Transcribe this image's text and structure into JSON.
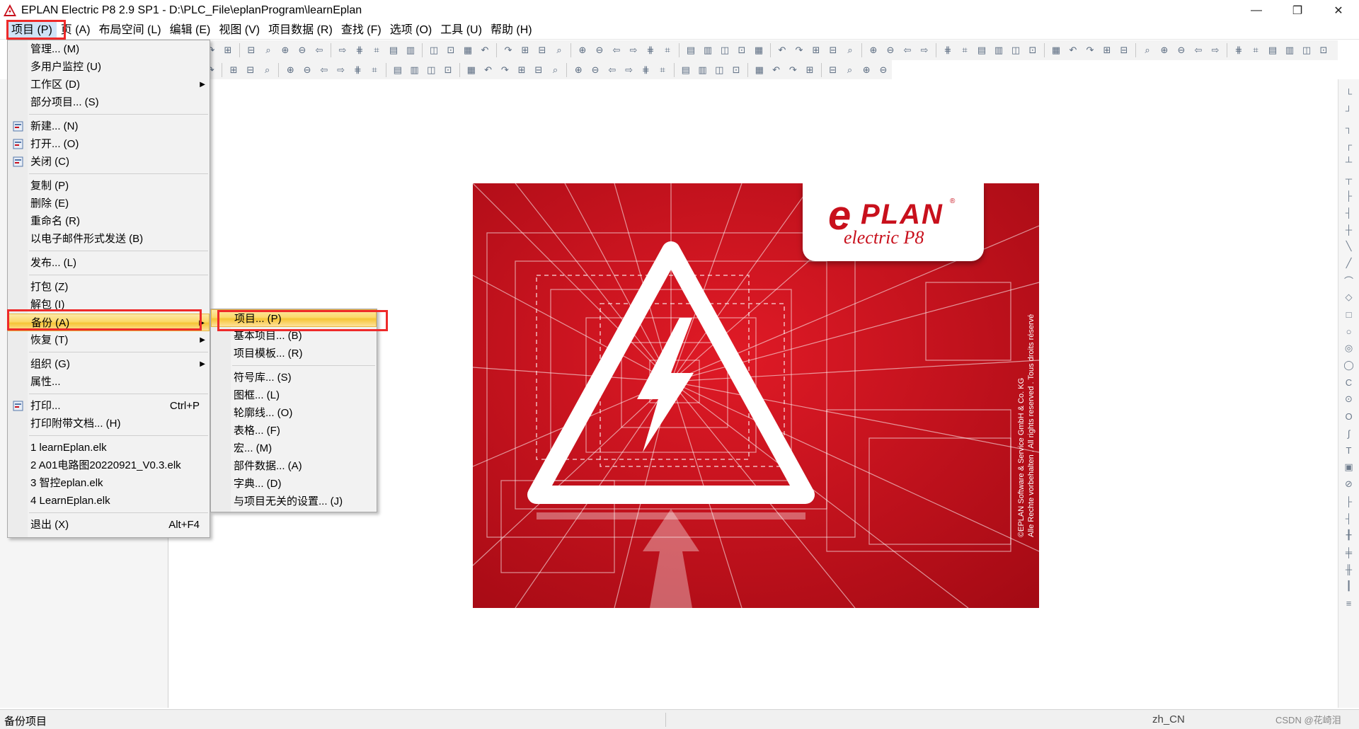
{
  "window": {
    "title": "EPLAN Electric P8 2.9 SP1 - D:\\PLC_File\\eplanProgram\\learnEplan",
    "min_symbol": "—",
    "restore_symbol": "❐",
    "close_symbol": "✕"
  },
  "menubar": {
    "items": [
      {
        "label": "项目 (P)"
      },
      {
        "label": "页 (A)"
      },
      {
        "label": "布局空间 (L)"
      },
      {
        "label": "编辑 (E)"
      },
      {
        "label": "视图 (V)"
      },
      {
        "label": "项目数据 (R)"
      },
      {
        "label": "查找 (F)"
      },
      {
        "label": "选项 (O)"
      },
      {
        "label": "工具 (U)"
      },
      {
        "label": "帮助 (H)"
      }
    ]
  },
  "project_menu": {
    "items": [
      {
        "label": "管理... (M)"
      },
      {
        "label": "多用户监控 (U)"
      },
      {
        "label": "工作区 (D)",
        "submenu": true
      },
      {
        "label": "部分项目... (S)"
      },
      {
        "sep": true
      },
      {
        "label": "新建... (N)",
        "icon": "new-project-icon"
      },
      {
        "label": "打开... (O)",
        "icon": "open-project-icon"
      },
      {
        "label": "关闭 (C)",
        "icon": "close-project-icon"
      },
      {
        "sep": true
      },
      {
        "label": "复制 (P)"
      },
      {
        "label": "删除 (E)"
      },
      {
        "label": "重命名 (R)"
      },
      {
        "label": "以电子邮件形式发送 (B)"
      },
      {
        "sep": true
      },
      {
        "label": "发布... (L)"
      },
      {
        "sep": true
      },
      {
        "label": "打包 (Z)"
      },
      {
        "label": "解包 (I)"
      },
      {
        "label": "备份 (A)",
        "submenu": true,
        "highlight": true
      },
      {
        "label": "恢复 (T)",
        "submenu": true
      },
      {
        "sep": true
      },
      {
        "label": "组织 (G)",
        "submenu": true
      },
      {
        "label": "属性..."
      },
      {
        "sep": true
      },
      {
        "label": "打印...",
        "shortcut": "Ctrl+P",
        "icon": "print-icon"
      },
      {
        "label": "打印附带文档... (H)"
      },
      {
        "sep": true
      },
      {
        "label": "1 learnEplan.elk"
      },
      {
        "label": "2 A01电路图20220921_V0.3.elk"
      },
      {
        "label": "3 智控eplan.elk"
      },
      {
        "label": "4 LearnEplan.elk"
      },
      {
        "sep": true
      },
      {
        "label": "退出 (X)",
        "shortcut": "Alt+F4"
      }
    ]
  },
  "backup_submenu": {
    "items": [
      {
        "label": "项目... (P)",
        "highlight": true
      },
      {
        "label": "基本项目... (B)"
      },
      {
        "label": "项目模板... (R)"
      },
      {
        "sep": true
      },
      {
        "label": "符号库... (S)"
      },
      {
        "label": "图框... (L)"
      },
      {
        "label": "轮廓线... (O)"
      },
      {
        "label": "表格... (F)"
      },
      {
        "label": "宏... (M)"
      },
      {
        "label": "部件数据... (A)"
      },
      {
        "label": "字典... (D)"
      },
      {
        "label": "与项目无关的设置... (J)"
      }
    ]
  },
  "splash": {
    "logo_e": "e",
    "logo_plan": "PLAN",
    "logo_reg": "®",
    "logo_sub": "electric P8",
    "copyright_line1": "©EPLAN Software & Service GmbH & Co. KG",
    "copyright_line2": "Alle Rechte vorbehalten . All rights reserved . Tous droits réservé"
  },
  "statusbar": {
    "left_text": "备份项目",
    "language": "zh_CN",
    "watermark": "CSDN @花崎泪"
  },
  "colors": {
    "brand_red": "#c8101c",
    "annotation_red": "#ee2a2a",
    "highlight_gold": "#f6c536"
  }
}
